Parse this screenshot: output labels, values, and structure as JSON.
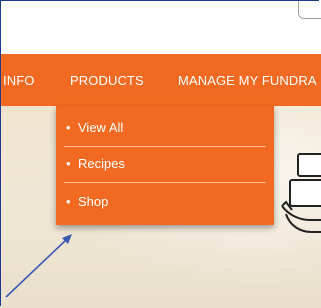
{
  "nav": {
    "items": [
      {
        "label": "INFO"
      },
      {
        "label": "PRODUCTS"
      },
      {
        "label": "MANAGE MY FUNDRA"
      }
    ]
  },
  "dropdown": {
    "items": [
      {
        "label": "View All"
      },
      {
        "label": "Recipes"
      },
      {
        "label": "Shop"
      }
    ],
    "bullet": "•"
  },
  "colors": {
    "nav_bg": "#f26a21",
    "annotation_arrow": "#3b5bb3"
  },
  "icons": {
    "hero_illustration": "shopping-box-hand-icon"
  }
}
